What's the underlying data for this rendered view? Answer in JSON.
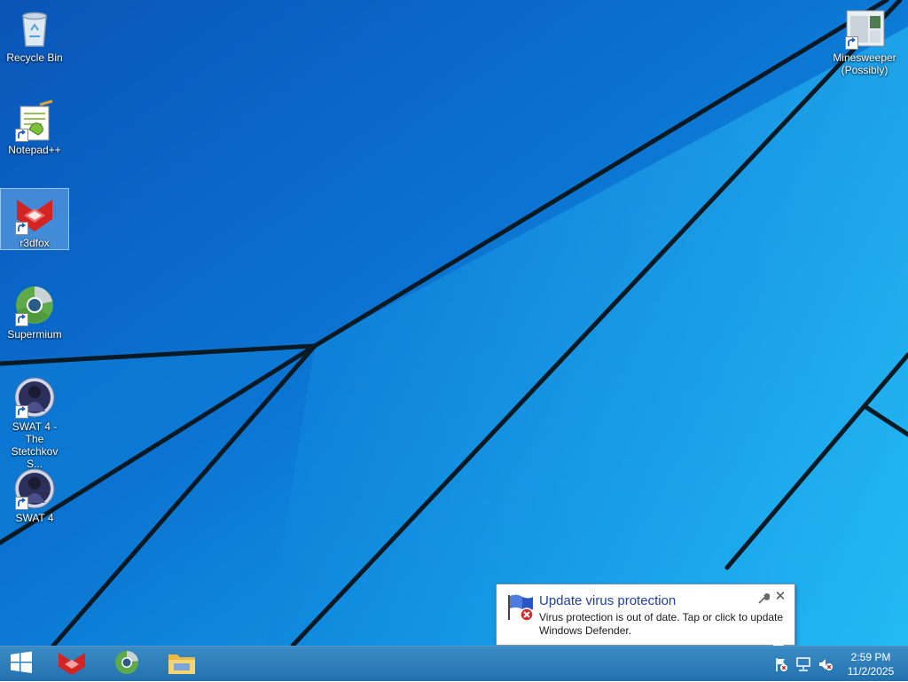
{
  "desktop": {
    "icons": [
      {
        "label": "Recycle Bin",
        "icon": "recycle-bin-icon"
      },
      {
        "label": "Notepad++",
        "icon": "notepad-plus-plus-icon"
      },
      {
        "label": "r3dfox",
        "icon": "r3dfox-icon",
        "selected": true
      },
      {
        "label": "Supermium",
        "icon": "supermium-icon"
      },
      {
        "label": "SWAT 4 - The Stetchkov S...",
        "icon": "swat4-icon"
      },
      {
        "label": "SWAT 4",
        "icon": "swat4-icon"
      },
      {
        "label": "Minesweeper (Possibly)",
        "icon": "minesweeper-icon"
      }
    ]
  },
  "taskbar": {
    "start_icon": "windows-logo-icon",
    "pinned": [
      "r3dfox",
      "Supermium",
      "File Explorer"
    ],
    "tray": [
      "action-center-flag-icon",
      "network-icon",
      "volume-muted-icon"
    ],
    "clock_time": "2:59 PM",
    "clock_date": "11/2/2025"
  },
  "notification": {
    "title": "Update virus protection",
    "body": "Virus protection is out of date. Tap or click to update Windows Defender.",
    "close_glyph": "✕"
  },
  "colors": {
    "desktop_blue": "#0f8ee0",
    "taskbar": "#1f78b8",
    "balloon_title": "#1e3fa6"
  }
}
